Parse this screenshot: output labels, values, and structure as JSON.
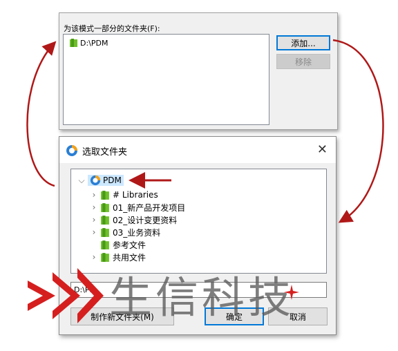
{
  "schema_panel": {
    "label": "为该模式一部分的文件夹(F):",
    "folders": [
      "D:\\PDM"
    ],
    "add_button": "添加...",
    "remove_button": "移除"
  },
  "dialog": {
    "title": "选取文件夹",
    "close_glyph": "✕",
    "tree": {
      "root": "PDM",
      "children": [
        {
          "label": "# Libraries",
          "expandable": true
        },
        {
          "label": "01_新产品开发项目",
          "expandable": true
        },
        {
          "label": "02_设计变更资料",
          "expandable": true
        },
        {
          "label": "03_业务资料",
          "expandable": true
        },
        {
          "label": "参考文件",
          "expandable": false
        },
        {
          "label": "共用文件",
          "expandable": true
        }
      ]
    },
    "path_value": "D:\\PD",
    "new_folder_button": "制作新文件夹(M)",
    "ok_button": "确定",
    "cancel_button": "取消"
  },
  "watermark": {
    "text": "生信科技"
  },
  "colors": {
    "arrow": "#b01818",
    "selection": "#cce8ff",
    "folder": "#6fbf2a",
    "accent": "#0078d7"
  }
}
